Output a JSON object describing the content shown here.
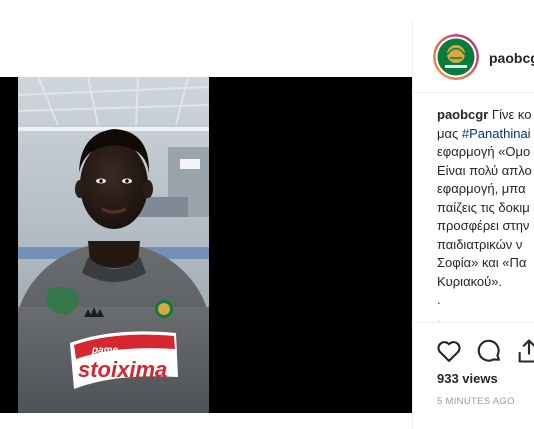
{
  "post": {
    "username": "paobcgr",
    "caption_lines": [
      {
        "before": "Γίνε κο",
        "tag": ""
      },
      {
        "before": "μας ",
        "tag": "#Panathinai"
      },
      {
        "before": "εφαρμογή «Ομο",
        "tag": ""
      },
      {
        "before": "Είναι πολύ απλο",
        "tag": ""
      },
      {
        "before": "εφαρμογή, μπα",
        "tag": ""
      },
      {
        "before": "παίζεις τις δοκιμ",
        "tag": ""
      },
      {
        "before": "προσφέρει στην",
        "tag": ""
      },
      {
        "before": "παιδιατρικών ν",
        "tag": ""
      },
      {
        "before": "Σοφία» και «Πα",
        "tag": ""
      },
      {
        "before": "Κυριακού».",
        "tag": ""
      },
      {
        "before": ".",
        "tag": ""
      },
      {
        "before": ".",
        "tag": ""
      }
    ],
    "views": "933 views",
    "timestamp": "5 MINUTES AGO"
  },
  "video": {
    "jersey_sponsor_top": "pame",
    "jersey_sponsor_main": "stoixima"
  },
  "icons": {
    "like": "heart-icon",
    "comment": "comment-bubble-icon",
    "share": "share-icon",
    "avatar": "panathinaikos-logo"
  },
  "colors": {
    "hashtag": "#003569",
    "avatar_ring_start": "#f9a23c",
    "avatar_ring_end": "#b22483",
    "club_green": "#0b7a3e",
    "muted_text": "#999999"
  }
}
